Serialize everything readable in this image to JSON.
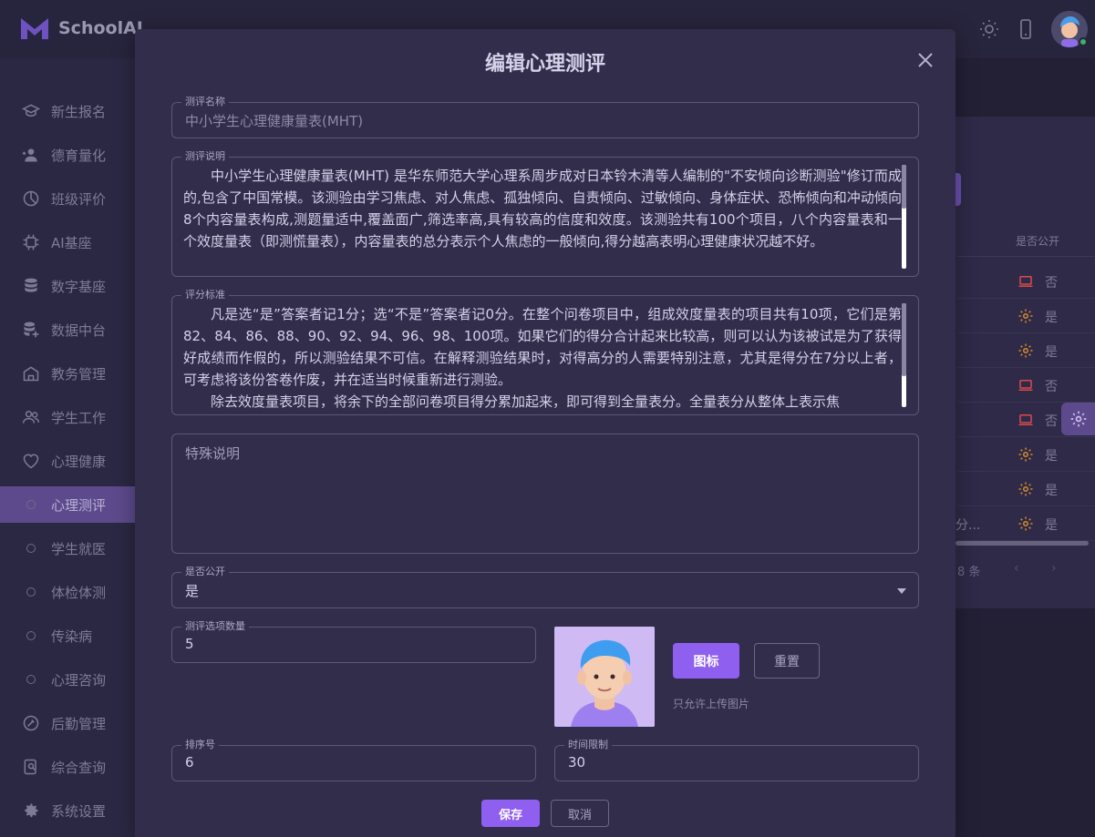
{
  "app": {
    "name": "SchoolAI"
  },
  "sidebar": {
    "items": [
      {
        "label": "新生报名",
        "icon": "graduation-cap-icon"
      },
      {
        "label": "德育量化",
        "icon": "user-plus-icon"
      },
      {
        "label": "班级评价",
        "icon": "chart-pie-icon"
      },
      {
        "label": "AI基座",
        "icon": "chip-icon"
      },
      {
        "label": "数字基座",
        "icon": "database-icon"
      },
      {
        "label": "数据中台",
        "icon": "database-plus-icon"
      },
      {
        "label": "教务管理",
        "icon": "building-icon"
      },
      {
        "label": "学生工作",
        "icon": "users-icon"
      },
      {
        "label": "心理健康",
        "icon": "heart-icon"
      },
      {
        "label": "心理测评",
        "icon": "circle-icon",
        "active": true
      },
      {
        "label": "学生就医",
        "icon": "circle-icon"
      },
      {
        "label": "体检体测",
        "icon": "circle-icon"
      },
      {
        "label": "传染病",
        "icon": "circle-icon"
      },
      {
        "label": "心理咨询",
        "icon": "circle-icon"
      },
      {
        "label": "后勤管理",
        "icon": "tools-icon"
      },
      {
        "label": "综合查询",
        "icon": "search-report-icon"
      },
      {
        "label": "系统设置",
        "icon": "gear-icon"
      }
    ]
  },
  "table": {
    "public_header": "是否公开",
    "rows": [
      {
        "icon": "laptop-icon",
        "value": "否"
      },
      {
        "icon": "gear-icon",
        "value": "是"
      },
      {
        "icon": "gear-icon",
        "value": "是"
      },
      {
        "icon": "laptop-icon",
        "value": "否"
      },
      {
        "icon": "laptop-icon",
        "value": "否"
      },
      {
        "icon": "gear-icon",
        "value": "是"
      },
      {
        "icon": "gear-icon",
        "value": "是"
      },
      {
        "icon": "gear-icon",
        "value": "是"
      }
    ],
    "truncated_cell": "分...",
    "total": "8 条"
  },
  "modal": {
    "title": "编辑心理测评",
    "name": {
      "label": "测评名称",
      "value": "中小学生心理健康量表(MHT)"
    },
    "description": {
      "label": "测评说明",
      "value": "中小学生心理健康量表(MHT) 是华东师范大学心理系周步成对日本铃木清等人编制的\"不安倾向诊断测验\"修订而成的,包含了中国常模。该测验由学习焦虑、对人焦虑、孤独倾向、自责倾向、过敏倾向、身体症状、恐怖倾向和冲动倾向8个内容量表构成,测题量适中,覆盖面广,筛选率高,具有较高的信度和效度。该测验共有100个项目，八个内容量表和一个效度量表（即测慌量表），内容量表的总分表示个人焦虑的一般倾向,得分越高表明心理健康状况越不好。"
    },
    "criteria": {
      "label": "评分标准",
      "paragraph1": "凡是选“是”答案者记1分；选“不是”答案者记0分。在整个问卷项目中，组成效度量表的项目共有10项，它们是第82、84、86、88、90、92、94、96、98、100项。如果它们的得分合计起来比较高，则可以认为该被试是为了获得好成绩而作假的，所以测验结果不可信。在解释测验结果时，对得高分的人需要特别注意，尤其是得分在7分以上者，可考虑将该份答卷作废，并在适当时候重新进行测验。",
      "paragraph2": "除去效度量表项目，将余下的全部问卷项目得分累加起来，即可得到全量表分。全量表分从整体上表示焦"
    },
    "special": {
      "placeholder": "特殊说明"
    },
    "public": {
      "label": "是否公开",
      "value": "是"
    },
    "option_count": {
      "label": "测评选项数量",
      "value": "5"
    },
    "icon_button": "图标",
    "reset_button": "重置",
    "upload_hint": "只允许上传图片",
    "sort": {
      "label": "排序号",
      "value": "6"
    },
    "time_limit": {
      "label": "时间限制",
      "value": "30"
    },
    "save_button": "保存",
    "cancel_button": "取消"
  },
  "colors": {
    "primary": "#8f5ff0",
    "modal_bg": "#312d4b",
    "sidebar_active": "#5d4a8c",
    "warning": "#d98a2b",
    "danger": "#d94b4b"
  }
}
